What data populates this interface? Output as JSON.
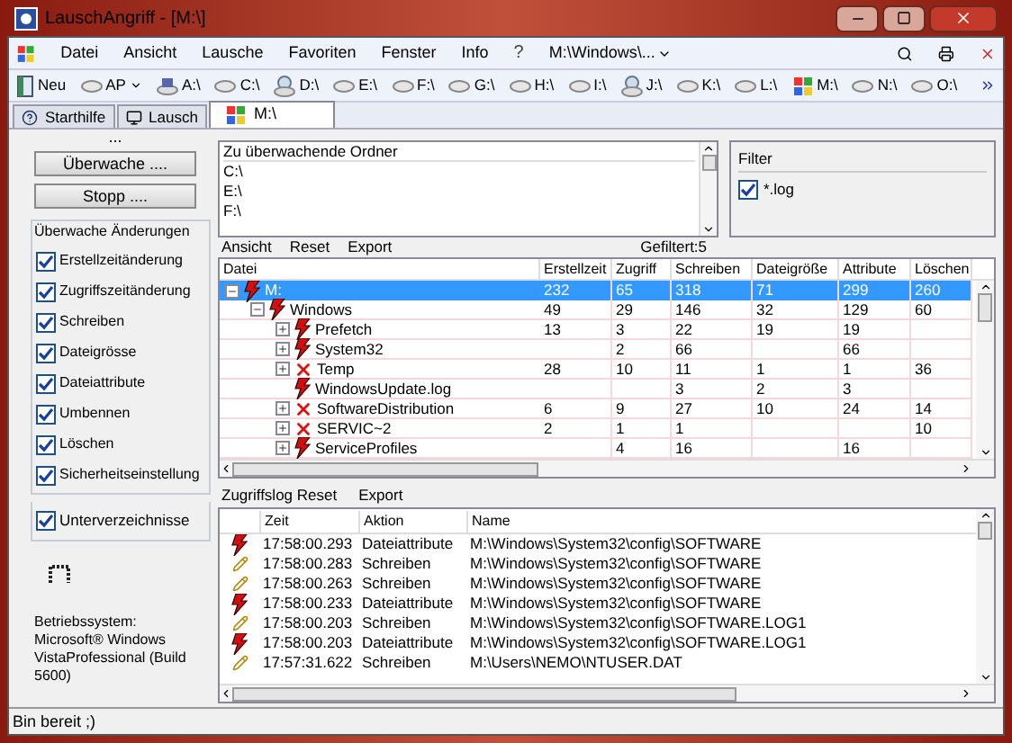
{
  "window": {
    "title": "LauschAngriff - [M:\\]"
  },
  "menu": [
    "Datei",
    "Ansicht",
    "Lausche",
    "Favoriten",
    "Fenster",
    "Info"
  ],
  "menu_right": {
    "help": "?",
    "path": "M:\\Windows\\..."
  },
  "toolbar": [
    {
      "label": "Neu",
      "kind": "new"
    },
    {
      "label": "AP",
      "kind": "dropdown"
    },
    {
      "label": "A:\\",
      "kind": "floppy"
    },
    {
      "label": "C:\\",
      "kind": "drive"
    },
    {
      "label": "D:\\",
      "kind": "cd"
    },
    {
      "label": "E:\\",
      "kind": "drive"
    },
    {
      "label": "F:\\",
      "kind": "drive"
    },
    {
      "label": "G:\\",
      "kind": "drive"
    },
    {
      "label": "H:\\",
      "kind": "drive"
    },
    {
      "label": "I:\\",
      "kind": "drive"
    },
    {
      "label": "J:\\",
      "kind": "cd"
    },
    {
      "label": "K:\\",
      "kind": "drive"
    },
    {
      "label": "L:\\",
      "kind": "drive"
    },
    {
      "label": "M:\\",
      "kind": "system"
    },
    {
      "label": "N:\\",
      "kind": "drive"
    },
    {
      "label": "O:\\",
      "kind": "drive"
    }
  ],
  "tabs": [
    {
      "label": "Starthilfe",
      "selected": false,
      "kind": "help"
    },
    {
      "label": "Lausch",
      "selected": false,
      "kind": "monitor"
    },
    {
      "label": "M:\\",
      "selected": true,
      "kind": "system"
    }
  ],
  "ellipsis": "...",
  "buttons": [
    "Überwache ....",
    "Stopp ...."
  ],
  "watch_group": {
    "title": "Überwache Änderungen",
    "options": [
      {
        "label": "Erstellzeitänderung",
        "checked": true
      },
      {
        "label": "Zugriffszeitänderung",
        "checked": true
      },
      {
        "label": "Schreiben",
        "checked": true
      },
      {
        "label": "Dateigrösse",
        "checked": true
      },
      {
        "label": "Dateiattribute",
        "checked": true
      },
      {
        "label": "Umbennen",
        "checked": true
      },
      {
        "label": "Löschen",
        "checked": true
      },
      {
        "label": "Sicherheitseinstellung",
        "checked": true
      }
    ]
  },
  "subdirs": {
    "label": "Unterverzeichnisse",
    "checked": true
  },
  "os_info": "Betriebssystem: Microsoft® Windows VistaProfessional (Build 5600)",
  "folders": {
    "title": "Zu überwachende Ordner",
    "items": [
      "C:\\",
      "E:\\",
      "F:\\"
    ]
  },
  "filter": {
    "title": "Filter",
    "items": [
      {
        "label": "*.log",
        "checked": true
      }
    ]
  },
  "tree_toolbar": [
    "Ansicht",
    "Reset",
    "Export"
  ],
  "filtered": "Gefiltert:5",
  "tree": {
    "name_column": "Datei",
    "columns": [
      "Erstellzeit",
      "Zugriff",
      "Schreiben",
      "Dateigröße",
      "Attribute",
      "Löschen"
    ],
    "rows": [
      {
        "name": "M:",
        "kind": "changed",
        "expanded": true,
        "selected": true,
        "cells": [
          "232",
          "65",
          "318",
          "71",
          "299",
          "260"
        ],
        "children": [
          {
            "name": "Windows",
            "kind": "changed",
            "expanded": true,
            "selected": false,
            "cells": [
              "49",
              "29",
              "146",
              "32",
              "129",
              "60"
            ],
            "children": [
              {
                "name": "Prefetch",
                "kind": "changed",
                "expanded": false,
                "selected": false,
                "cells": [
                  "13",
                  "3",
                  "22",
                  "19",
                  "19",
                  ""
                ]
              },
              {
                "name": "System32",
                "kind": "changed",
                "expanded": false,
                "selected": false,
                "cells": [
                  "",
                  "2",
                  "66",
                  "",
                  "66",
                  ""
                ]
              },
              {
                "name": "Temp",
                "kind": "deleted",
                "expanded": false,
                "selected": false,
                "cells": [
                  "28",
                  "10",
                  "11",
                  "1",
                  "1",
                  "36"
                ]
              },
              {
                "name": "WindowsUpdate.log",
                "kind": "file",
                "selected": false,
                "cells": [
                  "",
                  "",
                  "3",
                  "2",
                  "3",
                  ""
                ]
              },
              {
                "name": "SoftwareDistribution",
                "kind": "deleted",
                "expanded": false,
                "selected": false,
                "cells": [
                  "6",
                  "9",
                  "27",
                  "10",
                  "24",
                  "14"
                ]
              },
              {
                "name": "SERVIC~2",
                "kind": "deleted",
                "expanded": false,
                "selected": false,
                "cells": [
                  "2",
                  "1",
                  "1",
                  "",
                  "",
                  "10"
                ]
              },
              {
                "name": "ServiceProfiles",
                "kind": "changed",
                "expanded": false,
                "selected": false,
                "cells": [
                  "",
                  "4",
                  "16",
                  "",
                  "16",
                  ""
                ]
              }
            ]
          }
        ]
      }
    ]
  },
  "log_toolbar": [
    "Zugriffslog Reset",
    "Export"
  ],
  "log": {
    "columns": [
      "Zeit",
      "Aktion",
      "Name"
    ],
    "rows": [
      {
        "kind": "attributes",
        "time": "17:58:00.293",
        "action": "Dateiattribute",
        "name": "M:\\Windows\\System32\\config\\SOFTWARE"
      },
      {
        "kind": "write",
        "time": "17:58:00.283",
        "action": "Schreiben",
        "name": "M:\\Windows\\System32\\config\\SOFTWARE"
      },
      {
        "kind": "write",
        "time": "17:58:00.263",
        "action": "Schreiben",
        "name": "M:\\Windows\\System32\\config\\SOFTWARE"
      },
      {
        "kind": "attributes",
        "time": "17:58:00.233",
        "action": "Dateiattribute",
        "name": "M:\\Windows\\System32\\config\\SOFTWARE"
      },
      {
        "kind": "write",
        "time": "17:58:00.203",
        "action": "Schreiben",
        "name": "M:\\Windows\\System32\\config\\SOFTWARE.LOG1"
      },
      {
        "kind": "attributes",
        "time": "17:58:00.203",
        "action": "Dateiattribute",
        "name": "M:\\Windows\\System32\\config\\SOFTWARE.LOG1"
      },
      {
        "kind": "write",
        "time": "17:57:31.622",
        "action": "Schreiben",
        "name": "M:\\Users\\NEMO\\NTUSER.DAT"
      }
    ]
  },
  "status_bar": "Bin bereit ;)"
}
